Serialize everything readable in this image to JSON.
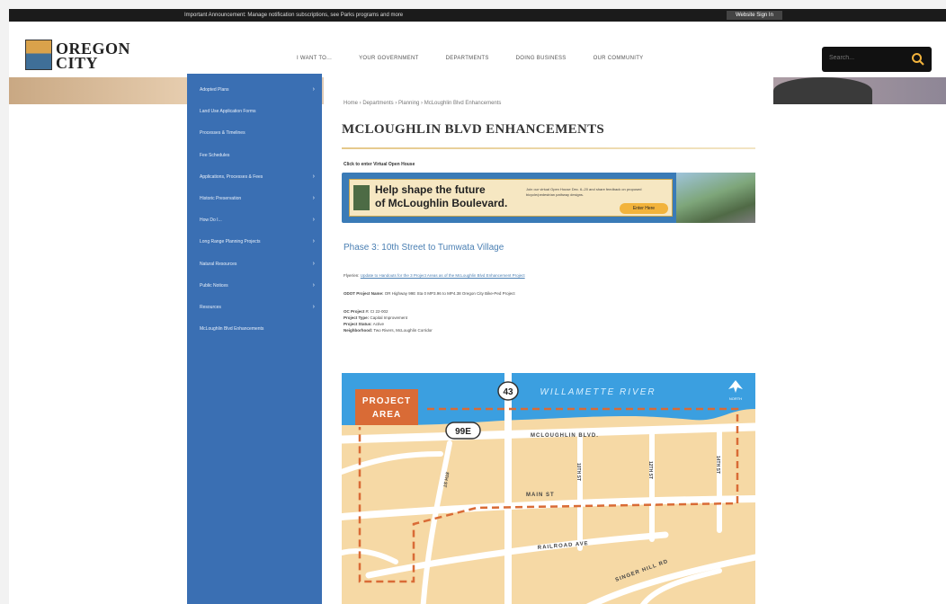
{
  "alert_bar": {
    "message": "Important Announcement: Manage notification subscriptions, see Parks programs and more",
    "signin": "Website Sign In"
  },
  "colors": {
    "sidebar": "#3a6fb3",
    "accent_gold": "#f2b33c",
    "map_land": "#f6d9a5",
    "river": "#3b9fe0",
    "project_area": "#d96b36"
  },
  "logo": {
    "line1": "OREGON",
    "line2": "CITY"
  },
  "nav": {
    "items": [
      "I WANT TO...",
      "YOUR GOVERNMENT",
      "DEPARTMENTS",
      "DOING BUSINESS",
      "OUR COMMUNITY"
    ]
  },
  "search": {
    "placeholder": "Search...",
    "icon": "search-icon"
  },
  "sidebar": {
    "items": [
      {
        "label": "Adopted Plans",
        "has_submenu": true
      },
      {
        "label": "Land Use Application Forms",
        "has_submenu": false
      },
      {
        "label": "Processes & Timelines",
        "has_submenu": false
      },
      {
        "label": "Fee Schedules",
        "has_submenu": false
      },
      {
        "label": "Applications, Processes & Fees",
        "has_submenu": true
      },
      {
        "label": "Historic Preservation",
        "has_submenu": true
      },
      {
        "label": "How Do I...",
        "has_submenu": true
      },
      {
        "label": "Long Range Planning Projects",
        "has_submenu": true
      },
      {
        "label": "Natural Resources",
        "has_submenu": true
      },
      {
        "label": "Public Notices",
        "has_submenu": true
      },
      {
        "label": "Resources",
        "has_submenu": true
      },
      {
        "label": "McLoughlin Blvd Enhancements",
        "has_submenu": false
      }
    ]
  },
  "breadcrumb": "Home › Departments › Planning › McLoughlin Blvd Enhancements",
  "page_title": "MCLOUGHLIN BLVD ENHANCEMENTS",
  "banner": {
    "label": "Click to enter Virtual Open House",
    "headline1": "Help shape the future",
    "headline2": "of McLoughlin Boulevard.",
    "blurb": "Join our virtual Open House Dec. 6–20 and share feedback on proposed bicycle/pedestrian pathway designs.",
    "cta": "Enter Here"
  },
  "phase_heading": "Phase 3: 10th Street to Tumwata Village",
  "meta": {
    "flyer_label": "Flyer/en:",
    "flyer_link": "Update to Handouts for the 3 Project Areas as of the McLoughlin Blvd Enhancement Project",
    "odot_label": "ODOT Project Name:",
    "odot_value": "OR Highway 99E Sta 0 MP3.96 to MP4.38 Oregon City Bike-Ped Project",
    "oc_label": "OC Project #:",
    "oc_value": "CI 22-002",
    "type_label": "Project Type:",
    "type_value": "Capital Improvement",
    "status_label": "Project Status:",
    "status_value": "Active",
    "neighborhood_label": "Neighborhood:",
    "neighborhood_value": "Two Rivers, McLoughlin Corridor"
  },
  "map": {
    "river_label": "WILLAMETTE RIVER",
    "highway_43": "43",
    "highway_99e": "99E",
    "project_area_line1": "PROJECT",
    "project_area_line2": "AREA",
    "north": "NORTH",
    "street_mcloughlin": "MCLOUGHLIN BLVD.",
    "street_main": "MAIN ST",
    "street_railroad": "RAILROAD AVE",
    "street_singer": "SINGER HILL RD",
    "street_8th": "8TH ST",
    "street_10th": "10TH ST",
    "street_12th": "12TH ST",
    "street_14th": "14TH ST"
  }
}
